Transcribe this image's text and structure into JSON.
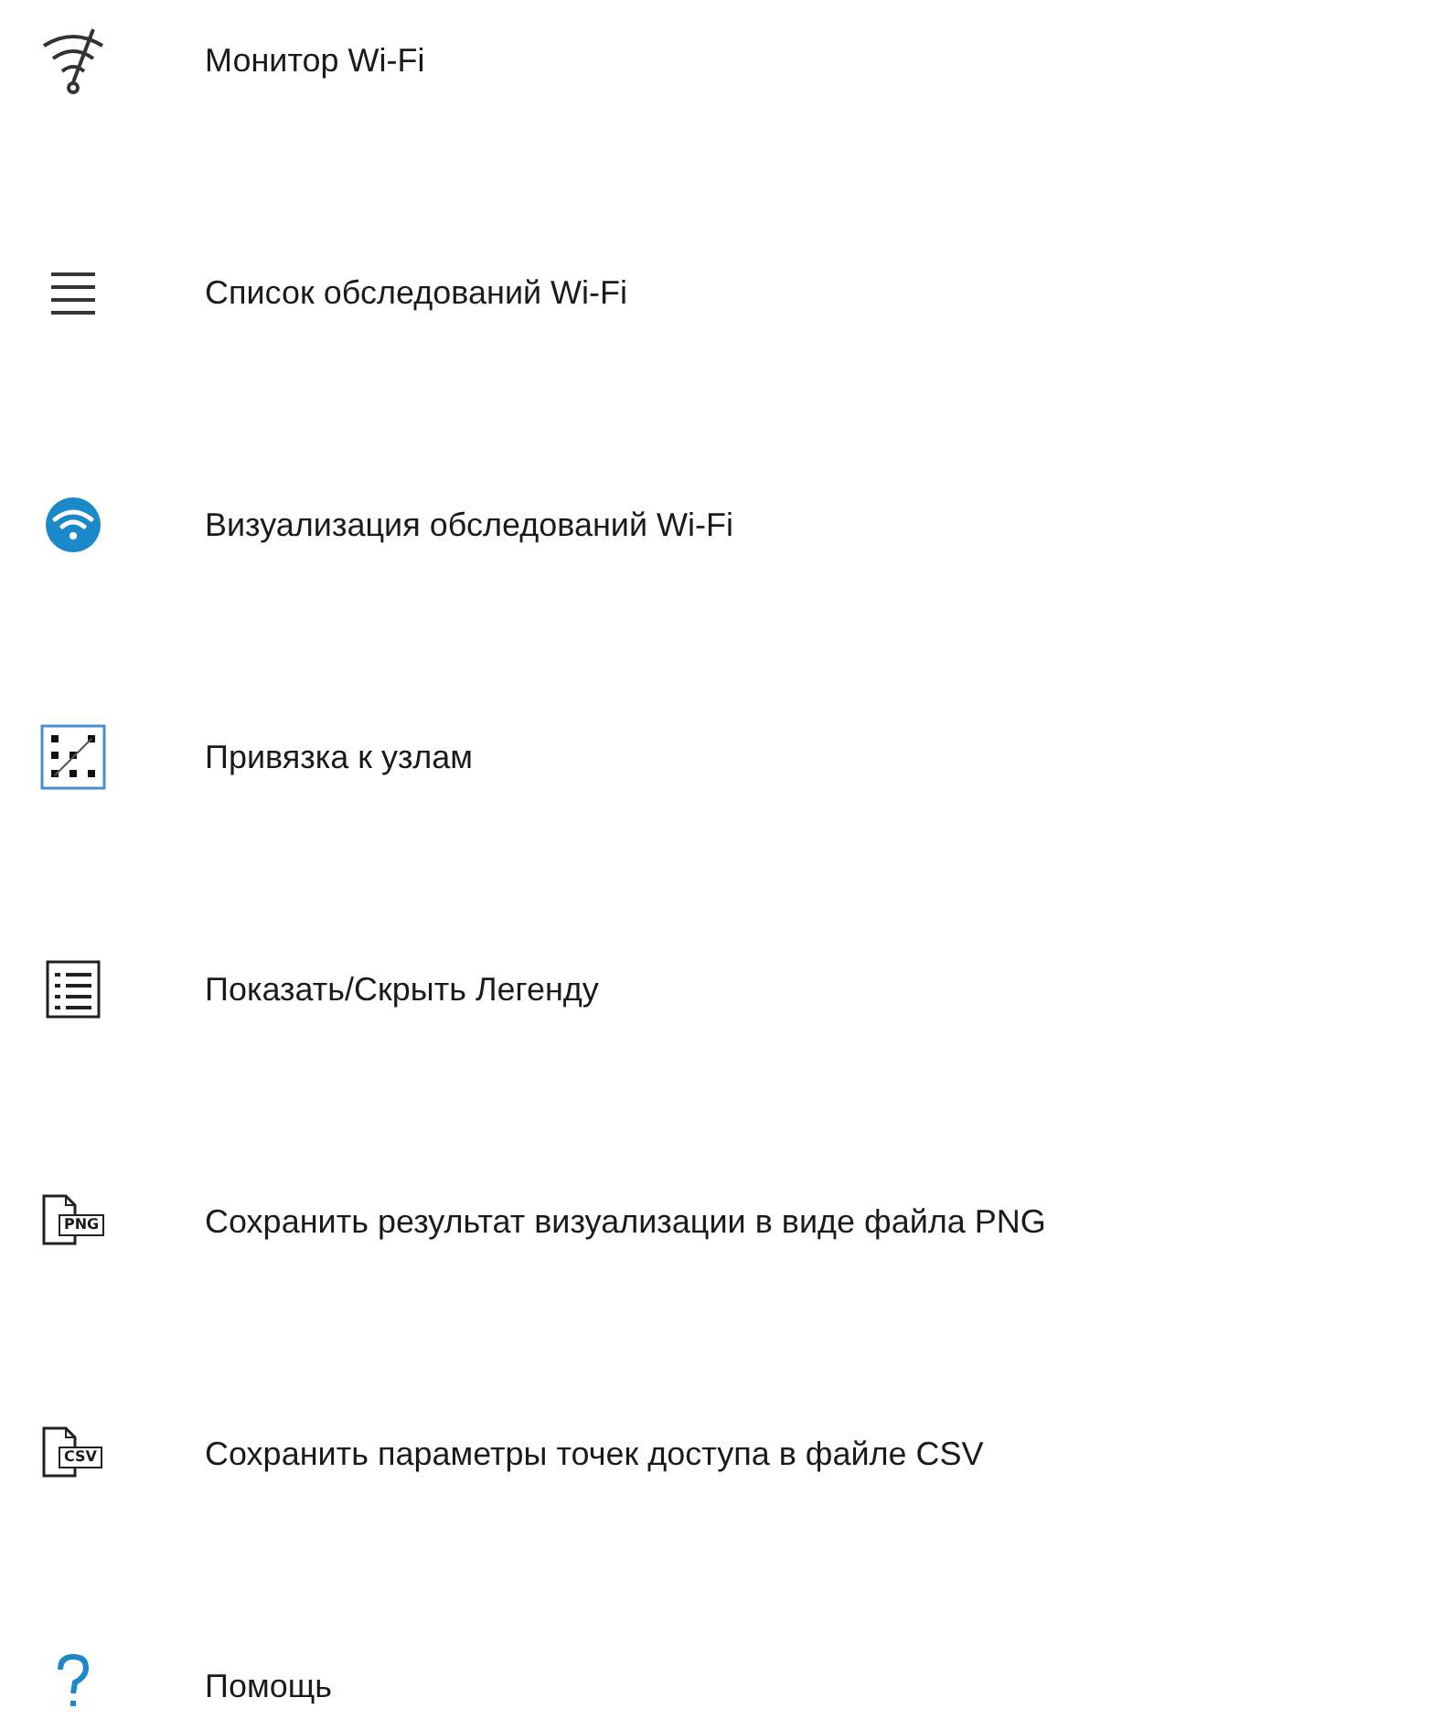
{
  "items": [
    {
      "kind": "wifi-monitor",
      "label": "Монитор Wi-Fi"
    },
    {
      "kind": "list",
      "label": "Список обследований Wi-Fi"
    },
    {
      "kind": "wifi-circle",
      "label": "Визуализация обследований Wi-Fi"
    },
    {
      "kind": "snap",
      "label": "Привязка к узлам"
    },
    {
      "kind": "legend",
      "label": "Показать/Скрыть Легенду"
    },
    {
      "kind": "file",
      "badge": "PNG",
      "label": "Сохранить результат визуализации в виде файла PNG"
    },
    {
      "kind": "file",
      "badge": "CSV",
      "label": "Сохранить параметры точек доступа в файле CSV"
    },
    {
      "kind": "help",
      "label": "Помощь"
    }
  ]
}
